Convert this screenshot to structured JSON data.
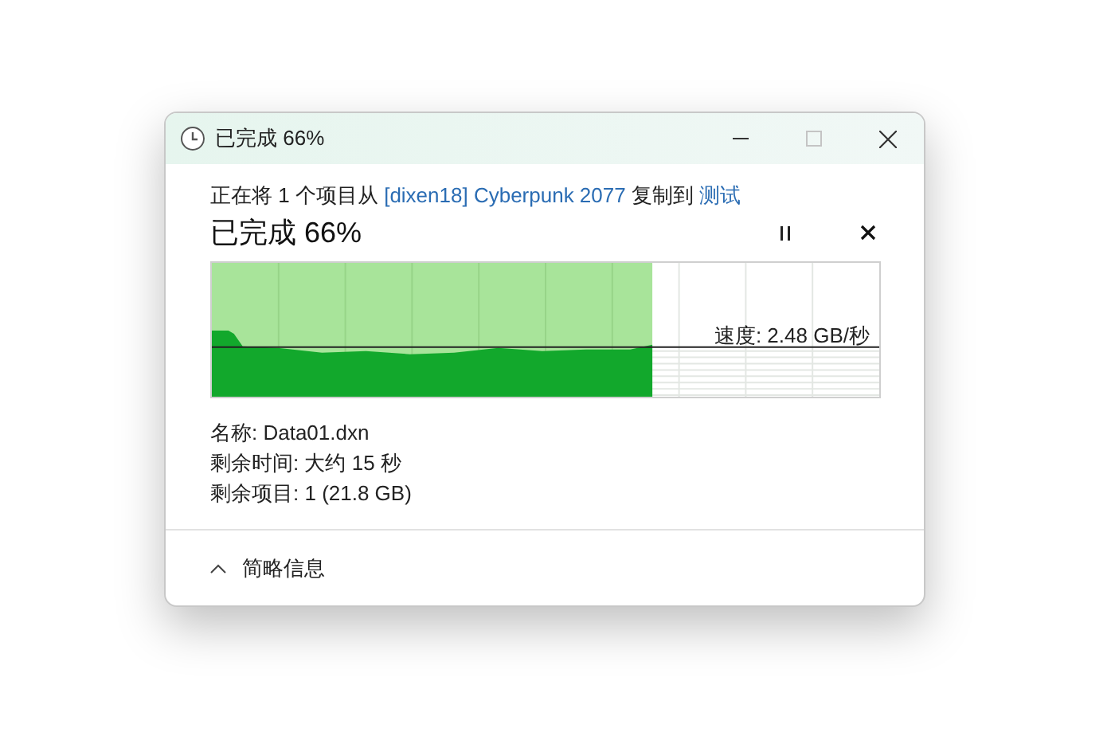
{
  "window": {
    "title": "已完成 66%"
  },
  "summary": [
    {
      "kind": "text",
      "text": "正在将 1 个项目从 "
    },
    {
      "kind": "link",
      "text": "[dixen18] Cyberpunk 2077"
    },
    {
      "kind": "text",
      "text": " 复制到 "
    },
    {
      "kind": "link",
      "text": "测试"
    }
  ],
  "heading": "已完成 66%",
  "progress": {
    "level": 0.66,
    "speed": "速度: 2.48 GB/秒"
  },
  "details": [
    "名称: Data01.dxn",
    "剩余时间: 大约 15 秒",
    "剩余项目: 1 (21.8 GB)"
  ],
  "footer": {
    "expanded": true,
    "label": "简略信息"
  }
}
